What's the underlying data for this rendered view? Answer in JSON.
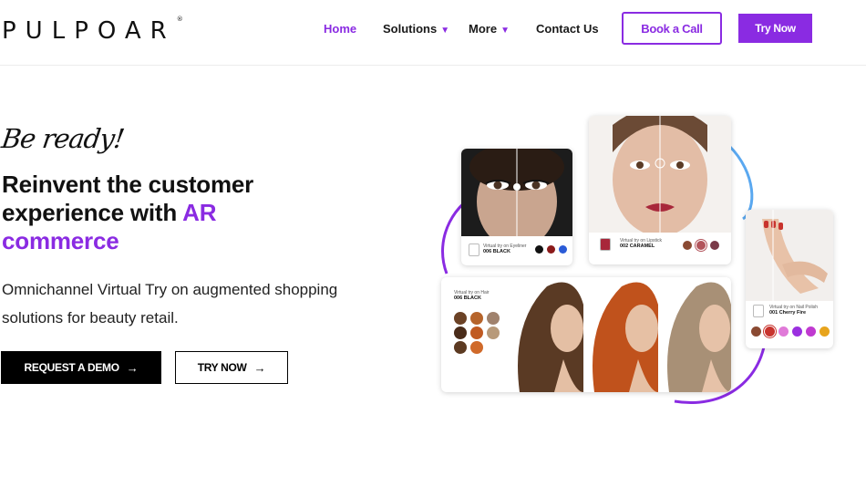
{
  "brand": {
    "logo_text": "PULPOAR",
    "registered": "®"
  },
  "nav": {
    "home": "Home",
    "solutions": "Solutions",
    "more": "More",
    "contact": "Contact Us",
    "caret": "▼",
    "book_call": "Book a Call",
    "try_now": "Try Now"
  },
  "hero": {
    "tagline": "Be ready!",
    "headline_part1": "Reinvent the customer experience with ",
    "headline_accent": "AR commerce",
    "subtext": "Omnichannel Virtual Try on augmented shopping solutions for beauty retail.",
    "btn_demo": "REQUEST A DEMO",
    "btn_try": "TRY NOW",
    "arrow": "→"
  },
  "cards": {
    "eyeliner": {
      "label": "Virtual try on Eyeliner",
      "product": "006 BLACK",
      "swatches": [
        "#111111",
        "#8b1a1a",
        "#2a5bd7"
      ]
    },
    "lipstick": {
      "label": "Virtual try on Lipstick",
      "product": "002 CARAMEL",
      "swatches": [
        "#8a4a32",
        "#b2545b",
        "#7a3a48"
      ]
    },
    "nail": {
      "label": "Virtual try on Nail Polish",
      "product": "001 Cherry Fire",
      "swatches": [
        "#8a4a32",
        "#c8332d",
        "#e07ad8",
        "#9b30e0",
        "#c03ad0",
        "#e7a41d"
      ]
    },
    "hair": {
      "label": "Virtual try on Hair",
      "product": "006 BLACK",
      "swatches": [
        "#6b4226",
        "#b6642b",
        "#a0826d",
        "#4a2c1a",
        "#c05a22",
        "#b89a7a",
        "#5c3a22",
        "#d06a2a"
      ]
    }
  },
  "colors": {
    "accent": "#8a2be2",
    "swirl_purple": "#8a2be2",
    "swirl_blue": "#5aa8f0"
  }
}
